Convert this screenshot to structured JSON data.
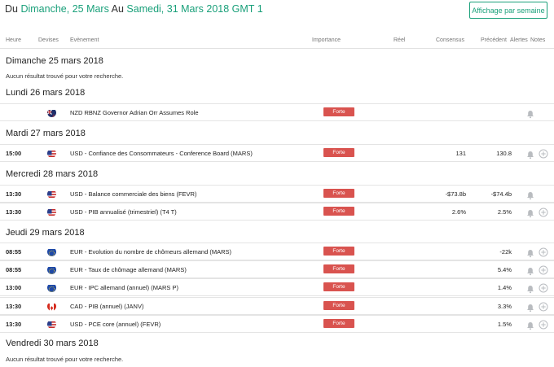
{
  "range": {
    "prefix": "Du",
    "start": "Dimanche, 25 Mars",
    "middle": "Au",
    "end": "Samedi, 31 Mars 2018",
    "tz": "GMT 1"
  },
  "week_button": "Affichage par semaine",
  "columns": {
    "heure": "Heure",
    "devises": "Devises",
    "evenement": "Evènement",
    "importance": "Importance",
    "reel": "Réel",
    "consensus": "Consensus",
    "precedent": "Précédent",
    "alertes": "Alertes",
    "notes": "Notes"
  },
  "days": [
    {
      "title": "Dimanche 25 mars 2018",
      "no_result": "Aucun résultat trouvé pour votre recherche."
    },
    {
      "title": "Lundi 26 mars 2018"
    },
    {
      "title": "Mardi 27 mars 2018"
    },
    {
      "title": "Mercredi 28 mars 2018"
    },
    {
      "title": "Jeudi 29 mars 2018"
    },
    {
      "title": "Vendredi 30 mars 2018",
      "no_result": "Aucun résultat trouvé pour votre recherche."
    }
  ],
  "events": [
    {
      "time": "",
      "flag": "nz-flag-icon",
      "event": "NZD RBNZ Governor Adrian Orr Assumes Role",
      "importance": "Forte",
      "consensus": "",
      "previous": "",
      "plus": false
    },
    {
      "time": "15:00",
      "flag": "us-flag-icon",
      "event": "USD - Confiance des Consommateurs - Conference Board (MARS)",
      "importance": "Forte",
      "consensus": "131",
      "previous": "130.8",
      "plus": true
    },
    {
      "time": "13:30",
      "flag": "us-flag-icon",
      "event": "USD - Balance commerciale des biens (FEVR)",
      "importance": "Forte",
      "consensus": "-$73.8b",
      "previous": "-$74.4b",
      "plus": false
    },
    {
      "time": "13:30",
      "flag": "us-flag-icon",
      "event": "USD - PIB annualisé (trimestriel) (T4 T)",
      "importance": "Forte",
      "consensus": "2.6%",
      "previous": "2.5%",
      "plus": true
    },
    {
      "time": "08:55",
      "flag": "eu-flag-icon",
      "event": "EUR - Evolution du nombre de chômeurs allemand (MARS)",
      "importance": "Forte",
      "consensus": "",
      "previous": "-22k",
      "plus": true
    },
    {
      "time": "08:55",
      "flag": "eu-flag-icon",
      "event": "EUR - Taux de chômage allemand (MARS)",
      "importance": "Forte",
      "consensus": "",
      "previous": "5.4%",
      "plus": true
    },
    {
      "time": "13:00",
      "flag": "eu-flag-icon",
      "event": "EUR - IPC allemand (annuel) (MARS P)",
      "importance": "Forte",
      "consensus": "",
      "previous": "1.4%",
      "plus": true
    },
    {
      "time": "13:30",
      "flag": "ca-flag-icon",
      "event": "CAD - PIB (annuel) (JANV)",
      "importance": "Forte",
      "consensus": "",
      "previous": "3.3%",
      "plus": true
    },
    {
      "time": "13:30",
      "flag": "us-flag-icon",
      "event": "USD - PCE core (annuel) (FEVR)",
      "importance": "Forte",
      "consensus": "",
      "previous": "1.5%",
      "plus": true
    }
  ],
  "colors": {
    "accent": "#1aa07a",
    "importance_high": "#d9534f"
  }
}
